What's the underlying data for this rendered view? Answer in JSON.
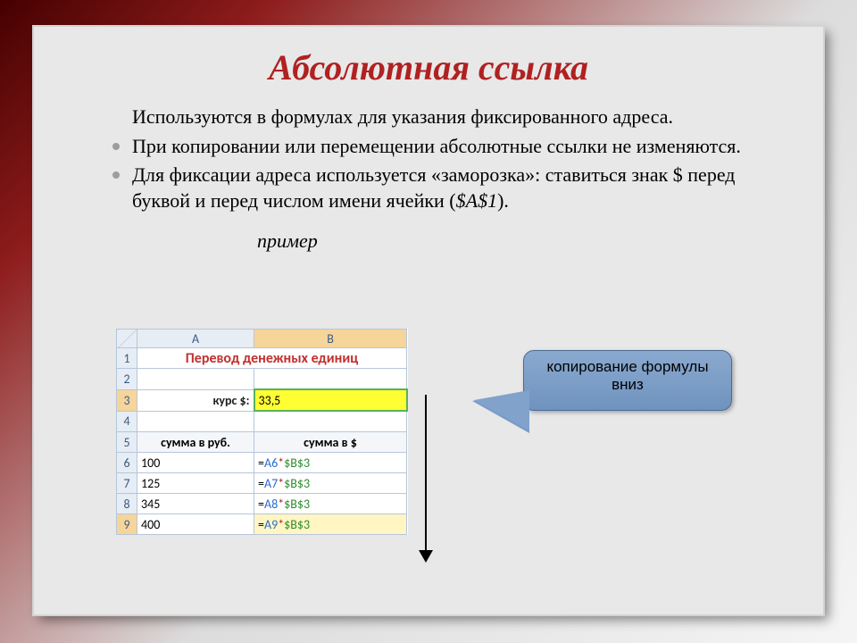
{
  "title": "Абсолютная ссылка",
  "bullets": {
    "b1": "Используются в формулах для указания фиксированного адреса.",
    "b2": "При копировании или перемещении абсолютные ссылки не изменяются.",
    "b3_pre": "Для фиксации адреса используется «заморозка»: ставиться знак $ перед буквой и перед числом имени ячейки (",
    "b3_em": "$A$1",
    "b3_post": ")."
  },
  "example_label": "пример",
  "callout": {
    "line1": "копирование формулы",
    "line2": "вниз"
  },
  "sheet": {
    "col_a": "A",
    "col_b": "B",
    "row1": "1",
    "row2": "2",
    "row3": "3",
    "row4": "4",
    "row5": "5",
    "row6": "6",
    "row7": "7",
    "row8": "8",
    "row9": "9",
    "merged_title": "Перевод денежных единиц",
    "kurs_label": "курс $:",
    "kurs_value": "33,5",
    "hdr_a": "сумма в руб.",
    "hdr_b": "сумма в $",
    "rows": [
      {
        "a": "100",
        "ref": "A6",
        "abs": "$B$3"
      },
      {
        "a": "125",
        "ref": "A7",
        "abs": "$B$3"
      },
      {
        "a": "345",
        "ref": "A8",
        "abs": "$B$3"
      },
      {
        "a": "400",
        "ref": "A9",
        "abs": "$B$3"
      }
    ]
  }
}
